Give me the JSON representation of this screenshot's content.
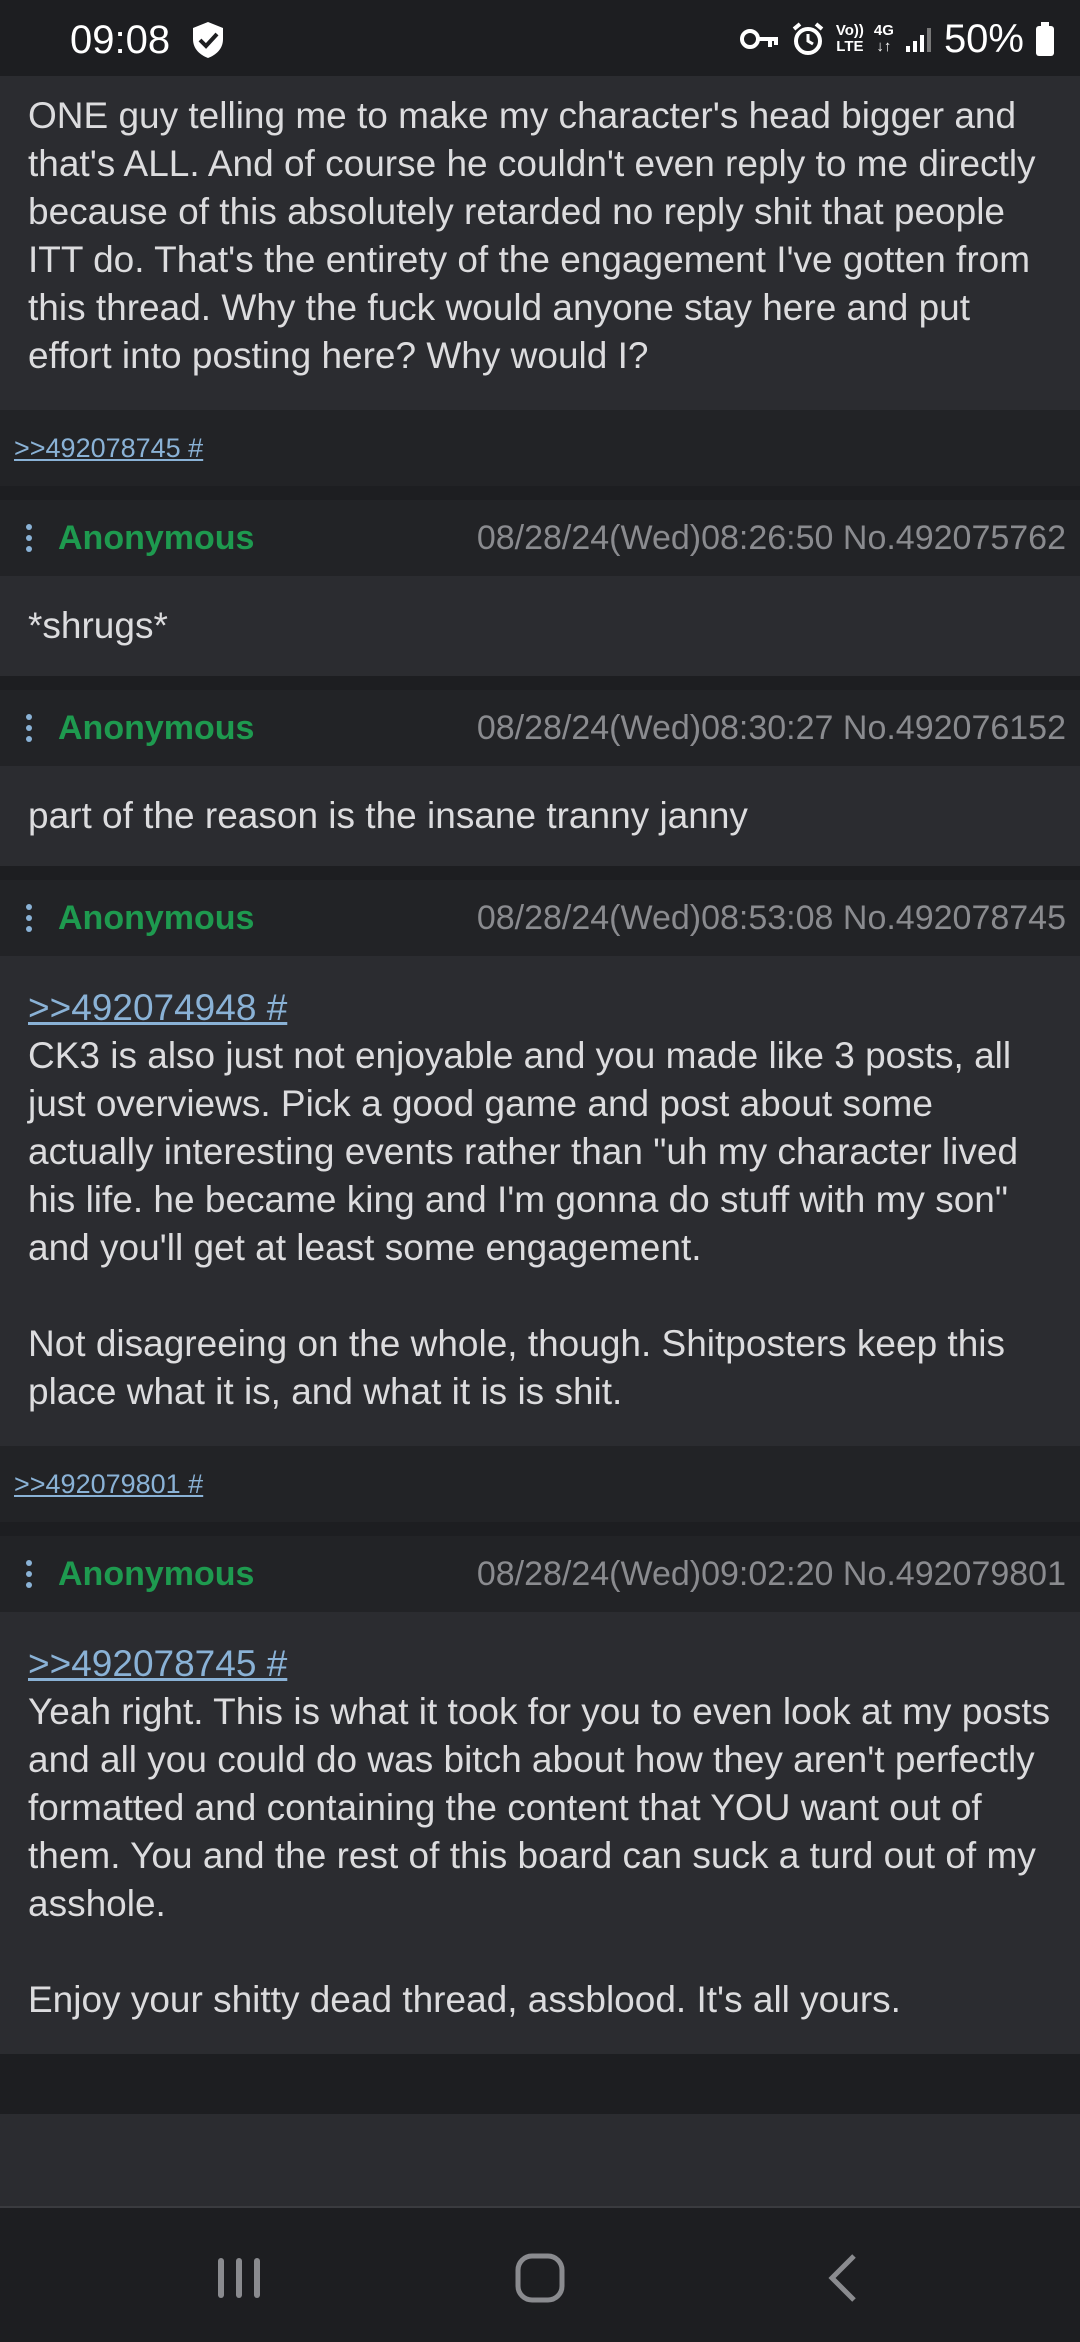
{
  "status_bar": {
    "time": "09:08",
    "network_top": "Vo))",
    "network_bottom": "LTE",
    "data_type": "4G",
    "battery": "50%"
  },
  "thread": {
    "top_post_text": "ONE guy telling me to make my character's head bigger and that's ALL. And of course he couldn't even reply to me directly because of this absolutely retarded no reply shit that people ITT do. That's the entirety of the engagement I've gotten from this thread. Why the fuck would anyone stay here and put effort into posting here? Why would I?",
    "top_post_replies": ">>492078745 #",
    "posts": [
      {
        "author": "Anonymous",
        "meta": "08/28/24(Wed)08:26:50 No.492075762",
        "text": "*shrugs*"
      },
      {
        "author": "Anonymous",
        "meta": "08/28/24(Wed)08:30:27 No.492076152",
        "text": "part of the reason is the insane tranny janny"
      },
      {
        "author": "Anonymous",
        "meta": "08/28/24(Wed)08:53:08 No.492078745",
        "quote": ">>492074948 #",
        "text": "CK3 is also just not enjoyable and you made like 3 posts, all just overviews. Pick a good game and post about some actually interesting events rather than \"uh my character lived his life. he became king and I'm gonna do stuff with my son\" and you'll get at least some engagement.\n\nNot disagreeing on the whole, though. Shitposters keep this place what it is, and what it is is shit.",
        "replies": ">>492079801 #"
      },
      {
        "author": "Anonymous",
        "meta": "08/28/24(Wed)09:02:20 No.492079801",
        "quote": ">>492078745 #",
        "text": "Yeah right. This is what it took for you to even look at my posts and all you could do was bitch about how they aren't perfectly formatted and containing the content that YOU want out of them. You and the rest of this board can suck a turd out of my asshole.\n\nEnjoy your shitty dead thread, assblood. It's all yours."
      }
    ]
  },
  "colors": {
    "background": "#2b2c30",
    "header_bg": "#222326",
    "author": "#1e9a4f",
    "link": "#8ab2d6",
    "meta": "#8a8b8f"
  },
  "icons": {
    "status": [
      "shield-check-icon",
      "vpn-key-icon",
      "alarm-icon",
      "signal-icon",
      "battery-icon"
    ],
    "nav": [
      "recent-apps-icon",
      "home-icon",
      "back-icon"
    ]
  }
}
